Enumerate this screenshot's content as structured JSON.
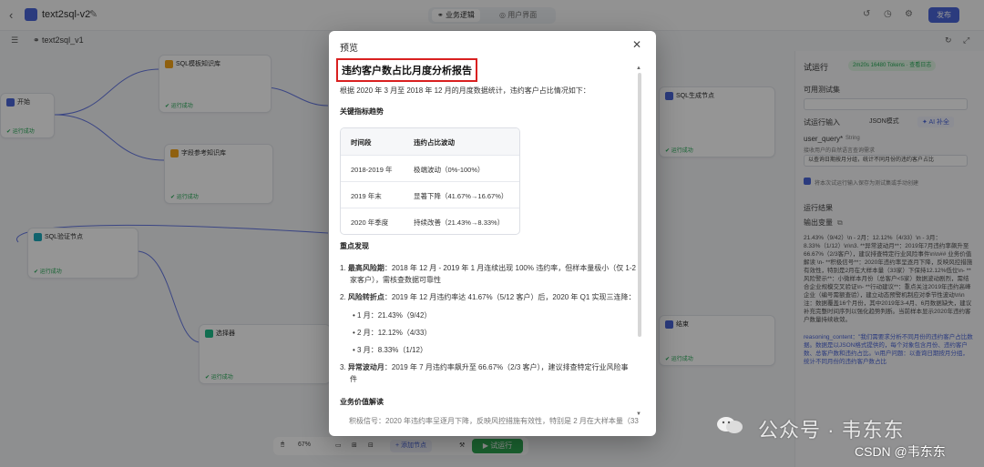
{
  "topbar": {
    "back_icon": "chevron-left-icon",
    "app_title": "text2sql-v2",
    "modes": [
      "业务逻辑",
      "用户界面"
    ],
    "publish_label": "发布"
  },
  "subbar": {
    "workflow_name": "text2sql_v1"
  },
  "canvas": {
    "nodes": [
      {
        "title": "开始",
        "status": "运行成功"
      },
      {
        "title": "SQL模板知识库",
        "status": "运行成功"
      },
      {
        "title": "字段参考知识库",
        "status": "运行成功"
      },
      {
        "title": "SQL验证节点",
        "status": "运行成功"
      },
      {
        "title": "选择器",
        "status": "运行成功"
      },
      {
        "title": "SQL生成节点",
        "status": "运行成功"
      },
      {
        "title": "结束",
        "status": "运行成功"
      }
    ]
  },
  "right_panel": {
    "title": "试运行",
    "token_badge": "2m20s 16480 Tokens · 查看日志",
    "test_set_label": "可用测试集",
    "test_input_label": "试运行输入",
    "json_mode_label": "JSON模式",
    "ai_fill_label": "AI 补全",
    "field_name": "user_query*",
    "field_type": "String",
    "field_desc": "接收用户的自然语言查询需求",
    "field_value": "以查询日期按月分组，统计不同月份的违约客户占比",
    "save_to_testset": "将本次试运行输入保存为测试集或手动创建",
    "result_label": "运行结果",
    "output_var_label": "输出变量",
    "output_text": "21.43%（9/42）\\n - 2月：12.12%（4/33）\\n - 3月：8.33%（1/12）\\n\\n3. **异常波动月**：2019年7月违约率飙升至66.67%（2/3客户），建议排查特定行业风险事件\\n\\n## 业务价值解读 \\n- **积极信号**：2020年违约率呈逐月下降，反映风控措施有效性，特别是2月在大样本量（33家）下保持12.12%低位\\n- **风险警示**：小微样本月份（总客户<5家）数据波动剧烈，需结合企业规模交叉验证\\n- **行动建议**：重点关注2019年违约高峰企业（编号需额查验），建立动态预警机制应对季节性波动\\n\\n 注：数据覆盖16个月份，其中2019年3-4月、6月数据缺失，建议补充完整时间序列以强化趋势判断。当前样本显示2020年违约客户数量持续收敛。",
    "reasoning_text": "reasoning_content：\"我们需要求分析不同月份的违约客户占比数据。数据是以JSON格式提供的，每个对象包含月份、违约客户数、总客户数和违约占比。\\n用户问题：以查询日期按月分组，统计不同月份的违约客户数占比"
  },
  "bottom_toolbar": {
    "zoom": "67%",
    "add_node_label": "添加节点",
    "run_label": "试运行"
  },
  "modal": {
    "title": "预览",
    "report_title": "违约客户数占比月度分析报告",
    "intro": "根据 2020 年 3 月至 2018 年 12 月的月度数据统计，违约客户占比情况如下：",
    "section_trend": "关键指标趋势",
    "table": {
      "headers": [
        "时间段",
        "违约占比波动"
      ],
      "rows": [
        [
          "2018-2019 年",
          "极端波动（0%-100%）"
        ],
        [
          "2019 年末",
          "显著下降（41.67%→16.67%）"
        ],
        [
          "2020 年季度",
          "持续改善（21.43%→8.33%）"
        ]
      ]
    },
    "section_findings": "重点发现",
    "findings": {
      "f1_label": "最高风险期",
      "f1_text": "：2018 年 12 月 - 2019 年 1 月连续出现 100% 违约率，但样本量极小（仅 1-2",
      "f1_text2": "家客户），需核查数据可靠性",
      "f2_label": "风险转折点",
      "f2_text": "：2019 年 12 月违约率达 41.67%（5/12 客户）后，2020 年 Q1 实现三连降：",
      "f2_items": [
        "1 月：21.43%（9/42）",
        "2 月：12.12%（4/33）",
        "3 月：8.33%（1/12）"
      ],
      "f3_label": "异常波动月",
      "f3_text": "：2019 年 7 月违约率飙升至 66.67%（2/3 客户），建议排查特定行业风险事",
      "f3_text2": "件"
    },
    "section_value": "业务价值解读",
    "cut_line": "积极信号：2020 年违约率呈逐月下降，反映风控措施有效性，特别是 2 月在大样本量（33"
  },
  "watermark": {
    "wechat_text": "公众号 · 韦东东",
    "csdn_text": "CSDN @韦东东"
  },
  "colors": {
    "accent": "#3f5bd6",
    "success": "#16a34a",
    "run_button": "#22a447",
    "highlight_border": "#d92020"
  }
}
